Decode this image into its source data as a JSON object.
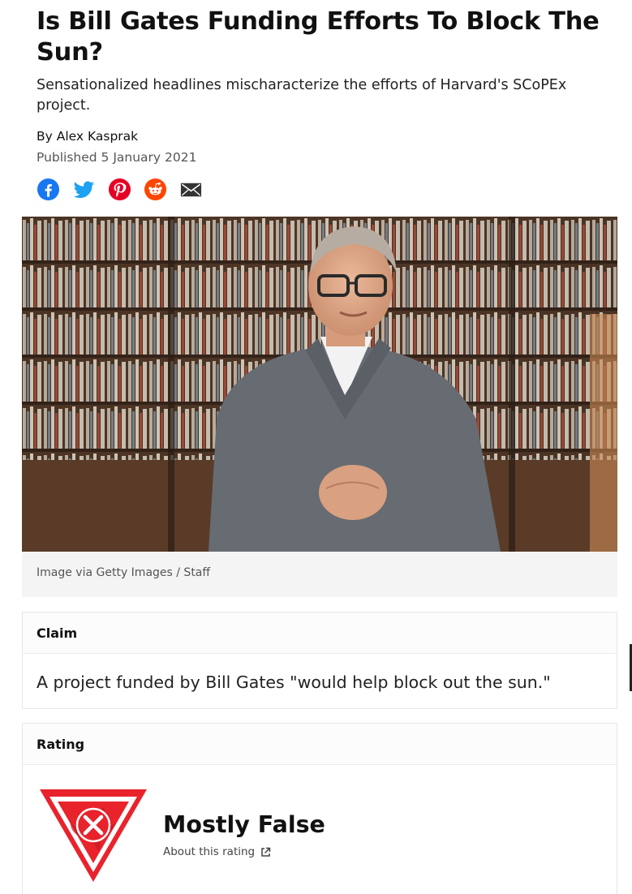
{
  "article": {
    "title": "Is Bill Gates Funding Efforts To Block The Sun?",
    "subtitle": "Sensationalized headlines mischaracterize the efforts of Harvard's SCoPEx project.",
    "byline": "By Alex Kasprak",
    "published": "Published 5 January 2021"
  },
  "share": {
    "icons": [
      "facebook-icon",
      "twitter-icon",
      "pinterest-icon",
      "reddit-icon",
      "email-icon"
    ],
    "colors": {
      "facebook": "#1877f2",
      "twitter": "#1da1f2",
      "pinterest": "#e60023",
      "reddit": "#ff4500",
      "email": "#333333"
    }
  },
  "image": {
    "caption": "Image via Getty Images / Staff"
  },
  "claim": {
    "heading": "Claim",
    "text": "A project funded by Bill Gates \"would help block out the sun.\""
  },
  "rating": {
    "heading": "Rating",
    "value": "Mostly False",
    "about_link": "About this rating",
    "badge_color": "#e8232c"
  }
}
